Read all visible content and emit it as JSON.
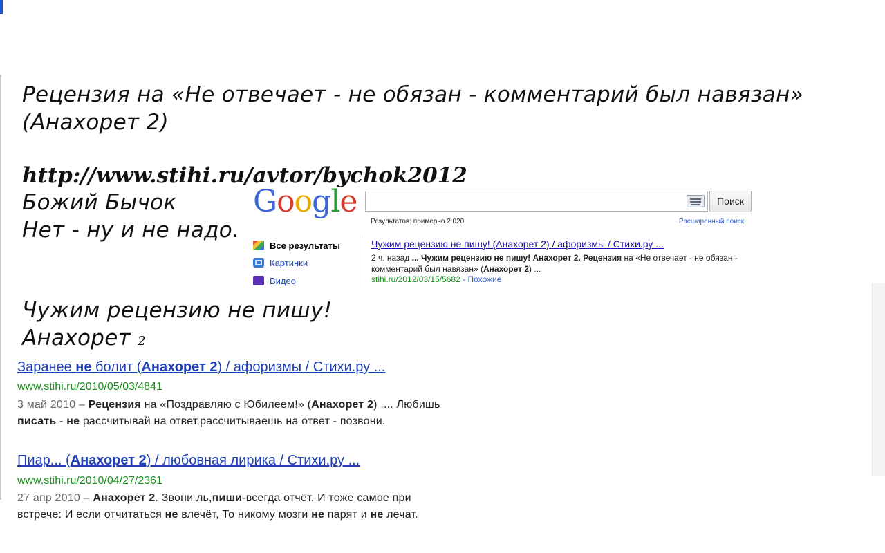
{
  "heading": {
    "review_line1": "Рецензия на «Не отвечает - не обязан - комментарий был навязан»",
    "review_line2": "(Анахорет 2)",
    "url": "http://www.stihi.ru/avtor/bychok2012",
    "author": "Божий Бычок",
    "reply": "Нет - ну и не надо.",
    "quote": "Чужим рецензию не пишу!",
    "signature_name": "Анахорет",
    "signature_num": "2"
  },
  "google": {
    "logo_letters": [
      "G",
      "o",
      "o",
      "g",
      "l",
      "e"
    ],
    "logo_colors": [
      "#3b67d6",
      "#d63b2f",
      "#f1b400",
      "#3b67d6",
      "#2f9b3c",
      "#d63b2f"
    ],
    "search_button": "Поиск",
    "results_count": "Результатов: примерно 2 020",
    "advanced_search": "Расширенный поиск",
    "sidebar": [
      {
        "label": "Все результаты",
        "icon": "google-all-results-icon",
        "active": true
      },
      {
        "label": "Картинки",
        "icon": "camera-icon",
        "active": false
      },
      {
        "label": "Видео",
        "icon": "film-icon",
        "active": false
      }
    ],
    "result": {
      "title": "Чужим рецензию не пишу! (Анахорет 2) / афоризмы / Стихи.ру ...",
      "snippet_time": "2 ч. назад",
      "snippet_part1": "...",
      "snippet_bold1": "Чужим рецензию не пишу! Анахорет 2. Рецензия",
      "snippet_part2": "на «Не отвечает - не обязан - комментарий был навязан» (",
      "snippet_bold2": "Анахорет 2",
      "snippet_part3": ") ...",
      "url": "stihi.ru/2012/03/15/5682",
      "separator": " - ",
      "similar": "Похожие"
    }
  },
  "results": [
    {
      "title_a": "Заранее ",
      "title_b": "не",
      "title_c": " болит (",
      "title_d": "Анахорет 2",
      "title_e": ") / афоризмы / Стихи.ру ...",
      "url": "www.stihi.ru/2010/05/03/4841",
      "date": "3 май 2010 –",
      "s1": "Рецензия",
      "s2": " на «Поздравляю с Юбилеем!» (",
      "s3": "Анахорет 2",
      "s4": ") .... Любишь",
      "s5": "писать",
      "s6": " - ",
      "s7": "не",
      "s8": " рассчитывай на ответ,рассчитываешь на ответ - позвони."
    },
    {
      "title_a": "Пиар... (",
      "title_b": "Анахорет 2",
      "title_c": ") / любовная лирика / Стихи.ру ...",
      "url": "www.stihi.ru/2010/04/27/2361",
      "date": "27 апр 2010 –",
      "s1": "Анахорет 2",
      "s2": ". Звони ль,",
      "s3": "пиши",
      "s4": "-всегда отчёт. И тоже самое при",
      "s5": "встрече: И если отчитаться ",
      "s6": "не",
      "s7": " влечёт, То никому мозги ",
      "s8": "не",
      "s9": " парят и ",
      "s10": "не",
      "s11": " лечат."
    }
  ]
}
